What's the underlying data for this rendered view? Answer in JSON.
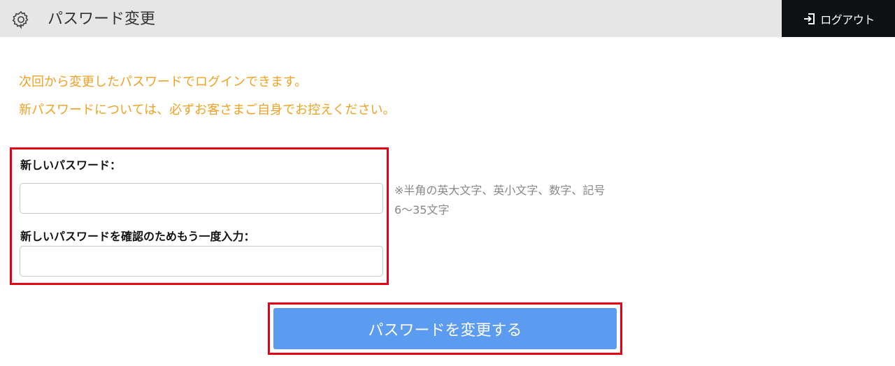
{
  "header": {
    "title": "パスワード変更",
    "settings_icon": "gear-icon",
    "logout_label": "ログアウト",
    "logout_icon": "logout-icon"
  },
  "messages": [
    "次回から変更したパスワードでログインできます。",
    "新パスワードについては、必ずお客さまご自身でお控えください。"
  ],
  "form": {
    "new_password_label": "新しいパスワード：",
    "new_password_value": "",
    "confirm_password_label": "新しいパスワードを確認のためもう一度入力：",
    "confirm_password_value": "",
    "hint_line1": "※半角の英大文字、英小文字、数字、記号",
    "hint_line2": "6〜35文字",
    "submit_label": "パスワードを変更する"
  },
  "colors": {
    "header_bg": "#e6e6e6",
    "logout_bg": "#0d1114",
    "message": "#f0a224",
    "highlight": "#e60012",
    "button": "#5b9bf0"
  }
}
